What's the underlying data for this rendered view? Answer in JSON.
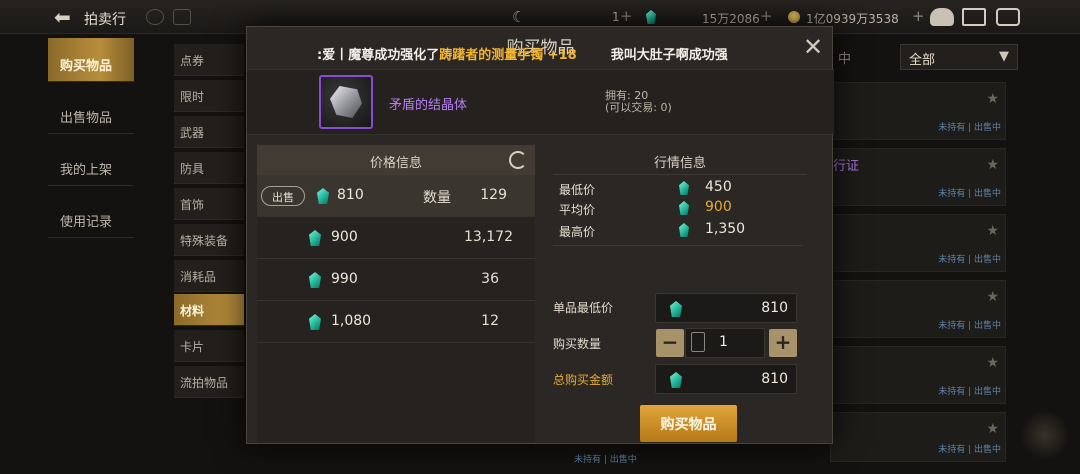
{
  "header": {
    "title": "拍卖行",
    "back_icon": "arrow-left-icon"
  },
  "currency": {
    "moon_value": "1",
    "gem_value": "15万2086",
    "gold_value": "1亿0939万3538"
  },
  "left_tabs": [
    {
      "label": "购买物品",
      "active": true
    },
    {
      "label": "出售物品",
      "active": false
    },
    {
      "label": "我的上架",
      "active": false
    },
    {
      "label": "使用记录",
      "active": false
    }
  ],
  "sub_tabs": [
    {
      "label": "点券",
      "active": false
    },
    {
      "label": "限时",
      "active": false
    },
    {
      "label": "武器",
      "active": false
    },
    {
      "label": "防具",
      "active": false
    },
    {
      "label": "首饰",
      "active": false
    },
    {
      "label": "特殊装备",
      "active": false
    },
    {
      "label": "消耗品",
      "active": false
    },
    {
      "label": "材料",
      "active": true
    },
    {
      "label": "卡片",
      "active": false
    },
    {
      "label": "流拍物品",
      "active": false
    }
  ],
  "filter": {
    "value": "全部",
    "partial_label": "中"
  },
  "background_list": {
    "row_status": "未持有 | 出售中",
    "partial_text": "行证"
  },
  "modal": {
    "title": "购买物品",
    "notice_prefix": ":爱丨魔尊成功强化了",
    "notice_item": "踌躇者的测量手镯 +18",
    "notice_suffix": "我叫大肚子啊成功强",
    "item_name": "矛盾的结晶体",
    "owned_line1": "拥有: 20",
    "owned_line2": "(可以交易: 0)",
    "price_header": "价格信息",
    "market_header": "行情信息",
    "sell_tag": "出售",
    "qty_label": "数量",
    "price_rows": [
      {
        "price": "810",
        "qty": "129",
        "selected": true
      },
      {
        "price": "900",
        "qty": "13,172",
        "selected": false
      },
      {
        "price": "990",
        "qty": "36",
        "selected": false
      },
      {
        "price": "1,080",
        "qty": "12",
        "selected": false
      }
    ],
    "market": {
      "min_label": "最低价",
      "min_value": "450",
      "avg_label": "平均价",
      "avg_value": "900",
      "max_label": "最高价",
      "max_value": "1,350"
    },
    "unit_min_label": "单品最低价",
    "unit_min_value": "810",
    "buy_qty_label": "购买数量",
    "buy_qty_value": "1",
    "total_label": "总购买金额",
    "total_value": "810",
    "buy_button": "购买物品"
  },
  "colors": {
    "accent_gold": "#e4ad35",
    "gem": "#23b79a",
    "rare_purple": "#b77ef2"
  }
}
